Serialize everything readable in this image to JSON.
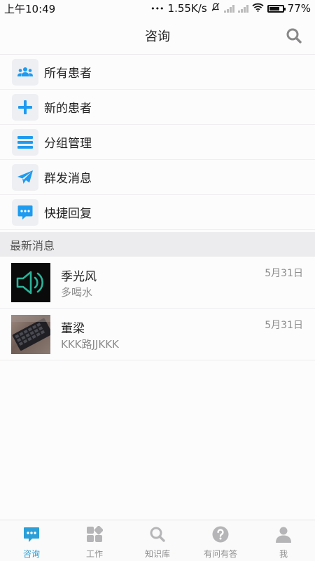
{
  "status": {
    "time": "上午10:49",
    "dots": "•••",
    "speed": "1.55K/s",
    "battery": "77%",
    "battery_level": 0.77
  },
  "header": {
    "title": "咨询",
    "search_icon": "search-icon"
  },
  "menu": [
    {
      "label": "所有患者",
      "icon": "people-icon"
    },
    {
      "label": "新的患者",
      "icon": "plus-icon"
    },
    {
      "label": "分组管理",
      "icon": "list-icon"
    },
    {
      "label": "群发消息",
      "icon": "send-icon"
    },
    {
      "label": "快捷回复",
      "icon": "chat-bubble-icon"
    }
  ],
  "section": {
    "title": "最新消息"
  },
  "messages": [
    {
      "name": "季光风",
      "preview": "多喝水",
      "date": "5月31日",
      "avatar": "speaker-icon"
    },
    {
      "name": "董梁",
      "preview": "KKK路JJKKK",
      "date": "5月31日",
      "avatar": "keyboard-photo"
    }
  ],
  "tabs": [
    {
      "label": "咨询",
      "icon": "chat-bubble-icon",
      "active": true
    },
    {
      "label": "工作",
      "icon": "grid-icon",
      "active": false
    },
    {
      "label": "知识库",
      "icon": "search-icon",
      "active": false
    },
    {
      "label": "有问有答",
      "icon": "question-icon",
      "active": false
    },
    {
      "label": "我",
      "icon": "person-icon",
      "active": false
    }
  ],
  "colors": {
    "accent": "#2a9fd8",
    "icon_blue": "#1d9bf0",
    "tab_inactive": "#b5b5b7"
  }
}
